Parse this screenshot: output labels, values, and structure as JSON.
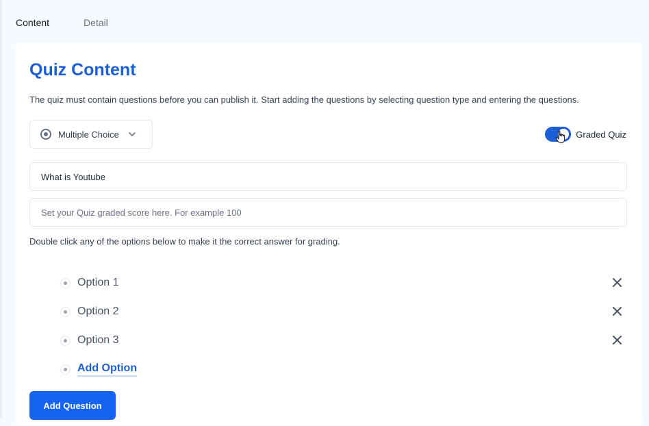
{
  "tabs": [
    {
      "label": "Content",
      "active": true
    },
    {
      "label": "Detail",
      "active": false
    }
  ],
  "quiz": {
    "title": "Quiz Content",
    "description": "The quiz must contain questions before you can publish it. Start adding the questions by selecting question type and entering the questions.",
    "question_type": {
      "icon": "radio-target-icon",
      "selected": "Multiple Choice"
    },
    "graded_toggle": {
      "label": "Graded Quiz",
      "on": true
    },
    "question_input": {
      "value": "What is Youtube"
    },
    "score_input": {
      "value": "",
      "placeholder": "Set your Quiz graded score here. For example 100"
    },
    "hint": "Double click any of the options below to make it the correct answer for grading.",
    "options": [
      {
        "label": "Option 1"
      },
      {
        "label": "Option 2"
      },
      {
        "label": "Option 3"
      }
    ],
    "add_option_label": "Add Option",
    "add_question_label": "Add Question"
  },
  "colors": {
    "accent": "#1d5fd6",
    "button": "#1463f3"
  }
}
